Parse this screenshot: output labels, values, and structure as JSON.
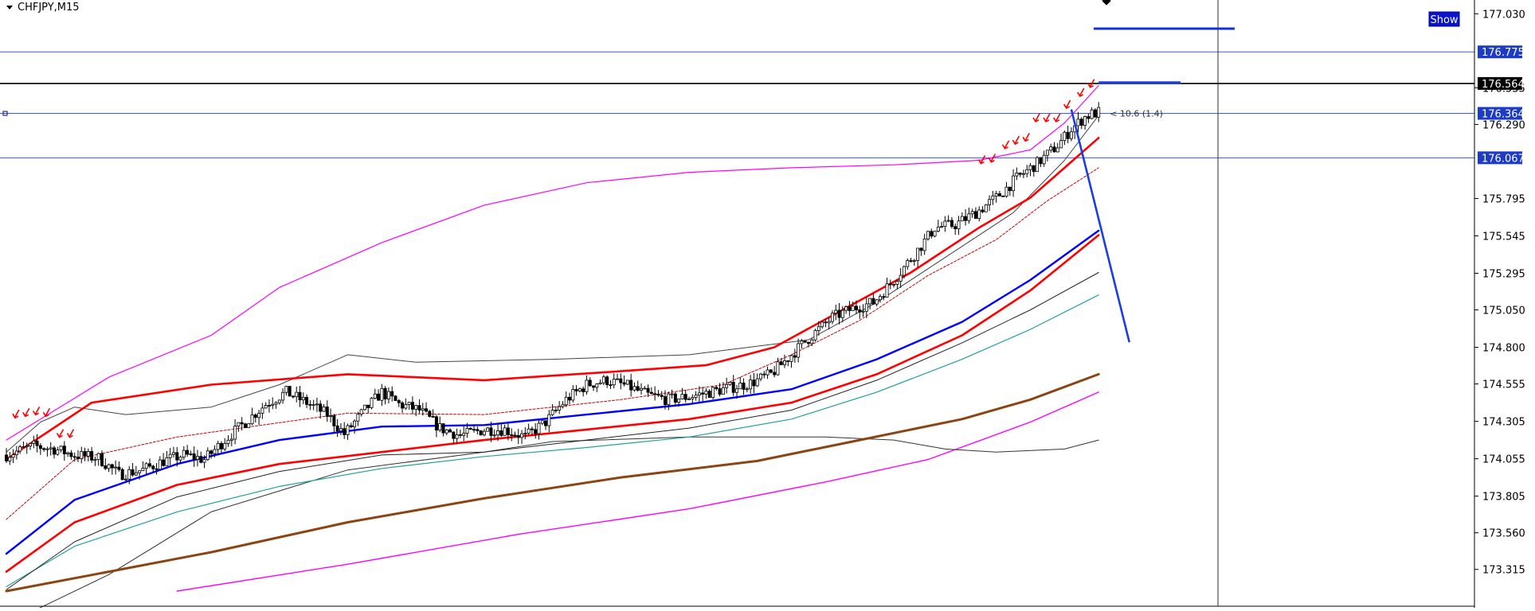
{
  "header": {
    "symbol_label": "CHFJPY,M15",
    "show_button": "Show",
    "measure_label": "< 10.6 (1.4)"
  },
  "colors": {
    "background": "#ffffff",
    "axis_text": "#000000",
    "price_line": "#000080",
    "level_line": "#3a5fcd",
    "blue_badge": "#1c3cc8",
    "black_badge": "#000000",
    "arrows": "#ff0000",
    "ma_red": "#ff0000",
    "ma_blue": "#0000ff",
    "ma_teal": "#20a0a0",
    "ma_brown": "#8b4513",
    "band_magenta": "#ff00ff",
    "trendline": "#1a3de0"
  },
  "chart_data": {
    "type": "candlestick",
    "symbol": "CHFJPY",
    "timeframe": "M15",
    "y_range": [
      173.17,
      177.09
    ],
    "y_ticks": [
      177.03,
      176.535,
      176.29,
      175.795,
      175.545,
      175.295,
      175.05,
      174.8,
      174.555,
      174.305,
      174.055,
      173.805,
      173.56,
      173.315
    ],
    "y_tick_labels": [
      "177.030",
      "176.535",
      "176.290",
      "175.795",
      "175.545",
      "175.295",
      "175.050",
      "174.800",
      "174.555",
      "174.305",
      "174.055",
      "173.805",
      "173.560",
      "173.315"
    ],
    "current_price": 176.364,
    "horizontal_levels": [
      {
        "price": 176.775,
        "label": "176.775",
        "style": "blue"
      },
      {
        "price": 176.564,
        "label": "176.564",
        "style": "black"
      },
      {
        "price": 176.364,
        "label": "176.364",
        "style": "blue"
      },
      {
        "price": 176.067,
        "label": "176.067",
        "style": "blue"
      }
    ],
    "close_path": [
      [
        0,
        174.08
      ],
      [
        8,
        174.14
      ],
      [
        14,
        174.12
      ],
      [
        20,
        174.08
      ],
      [
        27,
        174.06
      ],
      [
        33,
        173.95
      ],
      [
        40,
        173.98
      ],
      [
        46,
        174.04
      ],
      [
        52,
        174.08
      ],
      [
        58,
        174.05
      ],
      [
        64,
        174.18
      ],
      [
        70,
        174.3
      ],
      [
        76,
        174.42
      ],
      [
        82,
        174.5
      ],
      [
        88,
        174.43
      ],
      [
        94,
        174.35
      ],
      [
        99,
        174.22
      ],
      [
        105,
        174.38
      ],
      [
        110,
        174.5
      ],
      [
        115,
        174.42
      ],
      [
        121,
        174.38
      ],
      [
        127,
        174.26
      ],
      [
        133,
        174.21
      ],
      [
        140,
        174.25
      ],
      [
        146,
        174.25
      ],
      [
        152,
        174.2
      ],
      [
        158,
        174.3
      ],
      [
        164,
        174.45
      ],
      [
        170,
        174.55
      ],
      [
        176,
        174.58
      ],
      [
        182,
        174.54
      ],
      [
        188,
        174.48
      ],
      [
        194,
        174.45
      ],
      [
        200,
        174.47
      ],
      [
        206,
        174.5
      ],
      [
        212,
        174.53
      ],
      [
        218,
        174.56
      ],
      [
        224,
        174.62
      ],
      [
        230,
        174.75
      ],
      [
        236,
        174.88
      ],
      [
        242,
        175.0
      ],
      [
        248,
        175.06
      ],
      [
        254,
        175.1
      ],
      [
        260,
        175.25
      ],
      [
        266,
        175.42
      ],
      [
        272,
        175.6
      ],
      [
        278,
        175.62
      ],
      [
        284,
        175.7
      ],
      [
        290,
        175.8
      ],
      [
        296,
        175.93
      ],
      [
        302,
        176.03
      ],
      [
        308,
        176.15
      ],
      [
        312,
        176.26
      ],
      [
        316,
        176.34
      ],
      [
        318,
        176.36
      ],
      [
        320,
        176.37
      ]
    ],
    "candle_count": 321,
    "ma_fast_red": [
      [
        0,
        174.05
      ],
      [
        25,
        174.43
      ],
      [
        60,
        174.55
      ],
      [
        100,
        174.62
      ],
      [
        140,
        174.58
      ],
      [
        180,
        174.64
      ],
      [
        205,
        174.68
      ],
      [
        225,
        174.8
      ],
      [
        245,
        175.05
      ],
      [
        265,
        175.3
      ],
      [
        285,
        175.6
      ],
      [
        300,
        175.8
      ],
      [
        310,
        176.0
      ],
      [
        320,
        176.2
      ]
    ],
    "ma_signal_dotted": [
      [
        0,
        173.65
      ],
      [
        20,
        174.05
      ],
      [
        50,
        174.2
      ],
      [
        100,
        174.36
      ],
      [
        140,
        174.35
      ],
      [
        180,
        174.45
      ],
      [
        210,
        174.55
      ],
      [
        230,
        174.75
      ],
      [
        250,
        174.98
      ],
      [
        270,
        175.28
      ],
      [
        290,
        175.52
      ],
      [
        305,
        175.78
      ],
      [
        320,
        176.0
      ]
    ],
    "ma_thin_dark": [
      [
        0,
        174.1
      ],
      [
        10,
        174.3
      ],
      [
        20,
        174.4
      ],
      [
        35,
        174.35
      ],
      [
        60,
        174.4
      ],
      [
        80,
        174.55
      ],
      [
        100,
        174.75
      ],
      [
        120,
        174.7
      ],
      [
        160,
        174.72
      ],
      [
        200,
        174.75
      ],
      [
        235,
        174.85
      ],
      [
        255,
        175.1
      ],
      [
        275,
        175.4
      ],
      [
        295,
        175.7
      ],
      [
        310,
        176.05
      ],
      [
        320,
        176.35
      ]
    ],
    "ma_blue": [
      [
        0,
        173.42
      ],
      [
        20,
        173.78
      ],
      [
        50,
        174.02
      ],
      [
        80,
        174.18
      ],
      [
        110,
        174.27
      ],
      [
        140,
        174.28
      ],
      [
        170,
        174.35
      ],
      [
        200,
        174.42
      ],
      [
        230,
        174.52
      ],
      [
        255,
        174.72
      ],
      [
        280,
        174.97
      ],
      [
        300,
        175.25
      ],
      [
        320,
        175.58
      ]
    ],
    "ma_red_slow": [
      [
        0,
        173.3
      ],
      [
        20,
        173.63
      ],
      [
        50,
        173.88
      ],
      [
        80,
        174.02
      ],
      [
        110,
        174.1
      ],
      [
        140,
        174.18
      ],
      [
        170,
        174.25
      ],
      [
        200,
        174.32
      ],
      [
        230,
        174.43
      ],
      [
        255,
        174.62
      ],
      [
        280,
        174.88
      ],
      [
        300,
        175.18
      ],
      [
        320,
        175.55
      ]
    ],
    "ma_teal": [
      [
        0,
        173.2
      ],
      [
        20,
        173.47
      ],
      [
        50,
        173.7
      ],
      [
        80,
        173.87
      ],
      [
        110,
        173.99
      ],
      [
        140,
        174.07
      ],
      [
        170,
        174.13
      ],
      [
        200,
        174.2
      ],
      [
        230,
        174.32
      ],
      [
        255,
        174.5
      ],
      [
        280,
        174.72
      ],
      [
        300,
        174.92
      ],
      [
        320,
        175.15
      ]
    ],
    "ma_thin_black_2": [
      [
        0,
        173.18
      ],
      [
        20,
        173.5
      ],
      [
        50,
        173.8
      ],
      [
        80,
        173.97
      ],
      [
        110,
        174.08
      ],
      [
        140,
        174.1
      ],
      [
        170,
        174.18
      ],
      [
        200,
        174.26
      ],
      [
        230,
        174.38
      ],
      [
        255,
        174.58
      ],
      [
        280,
        174.83
      ],
      [
        300,
        175.05
      ],
      [
        320,
        175.3
      ]
    ],
    "ma_black_wave": [
      [
        0,
        172.95
      ],
      [
        30,
        173.28
      ],
      [
        60,
        173.7
      ],
      [
        100,
        173.98
      ],
      [
        140,
        174.1
      ],
      [
        160,
        174.17
      ],
      [
        200,
        174.2
      ],
      [
        240,
        174.2
      ],
      [
        260,
        174.18
      ],
      [
        275,
        174.12
      ],
      [
        290,
        174.1
      ],
      [
        310,
        174.12
      ],
      [
        320,
        174.18
      ]
    ],
    "ma_brown": [
      [
        0,
        173.17
      ],
      [
        30,
        173.3
      ],
      [
        60,
        173.43
      ],
      [
        100,
        173.63
      ],
      [
        140,
        173.79
      ],
      [
        180,
        173.93
      ],
      [
        220,
        174.04
      ],
      [
        250,
        174.18
      ],
      [
        280,
        174.32
      ],
      [
        300,
        174.45
      ],
      [
        320,
        174.62
      ]
    ],
    "band_magenta_upper": [
      [
        0,
        174.18
      ],
      [
        30,
        174.6
      ],
      [
        60,
        174.88
      ],
      [
        80,
        175.2
      ],
      [
        110,
        175.5
      ],
      [
        140,
        175.75
      ],
      [
        170,
        175.9
      ],
      [
        200,
        175.97
      ],
      [
        230,
        176.0
      ],
      [
        260,
        176.02
      ],
      [
        285,
        176.05
      ],
      [
        300,
        176.12
      ],
      [
        310,
        176.3
      ],
      [
        320,
        176.55
      ]
    ],
    "band_magenta_lower": [
      [
        50,
        173.17
      ],
      [
        100,
        173.35
      ],
      [
        150,
        173.55
      ],
      [
        200,
        173.72
      ],
      [
        240,
        173.9
      ],
      [
        270,
        174.05
      ],
      [
        300,
        174.3
      ],
      [
        320,
        174.5
      ]
    ],
    "down_arrows": [
      [
        3,
        174.35
      ],
      [
        6,
        174.36
      ],
      [
        9,
        174.37
      ],
      [
        12,
        174.36
      ],
      [
        16,
        174.22
      ],
      [
        19,
        174.22
      ],
      [
        286,
        176.05
      ],
      [
        289,
        176.06
      ],
      [
        293,
        176.15
      ],
      [
        296,
        176.18
      ],
      [
        299,
        176.2
      ],
      [
        302,
        176.33
      ],
      [
        305,
        176.33
      ],
      [
        308,
        176.33
      ],
      [
        311,
        176.42
      ],
      [
        315,
        176.5
      ],
      [
        318,
        176.56
      ]
    ],
    "trendline": [
      [
        312,
        176.39
      ],
      [
        322,
        175.1
      ]
    ],
    "trendline_short": [
      [
        320,
        176.57
      ],
      [
        344,
        176.57
      ]
    ]
  }
}
